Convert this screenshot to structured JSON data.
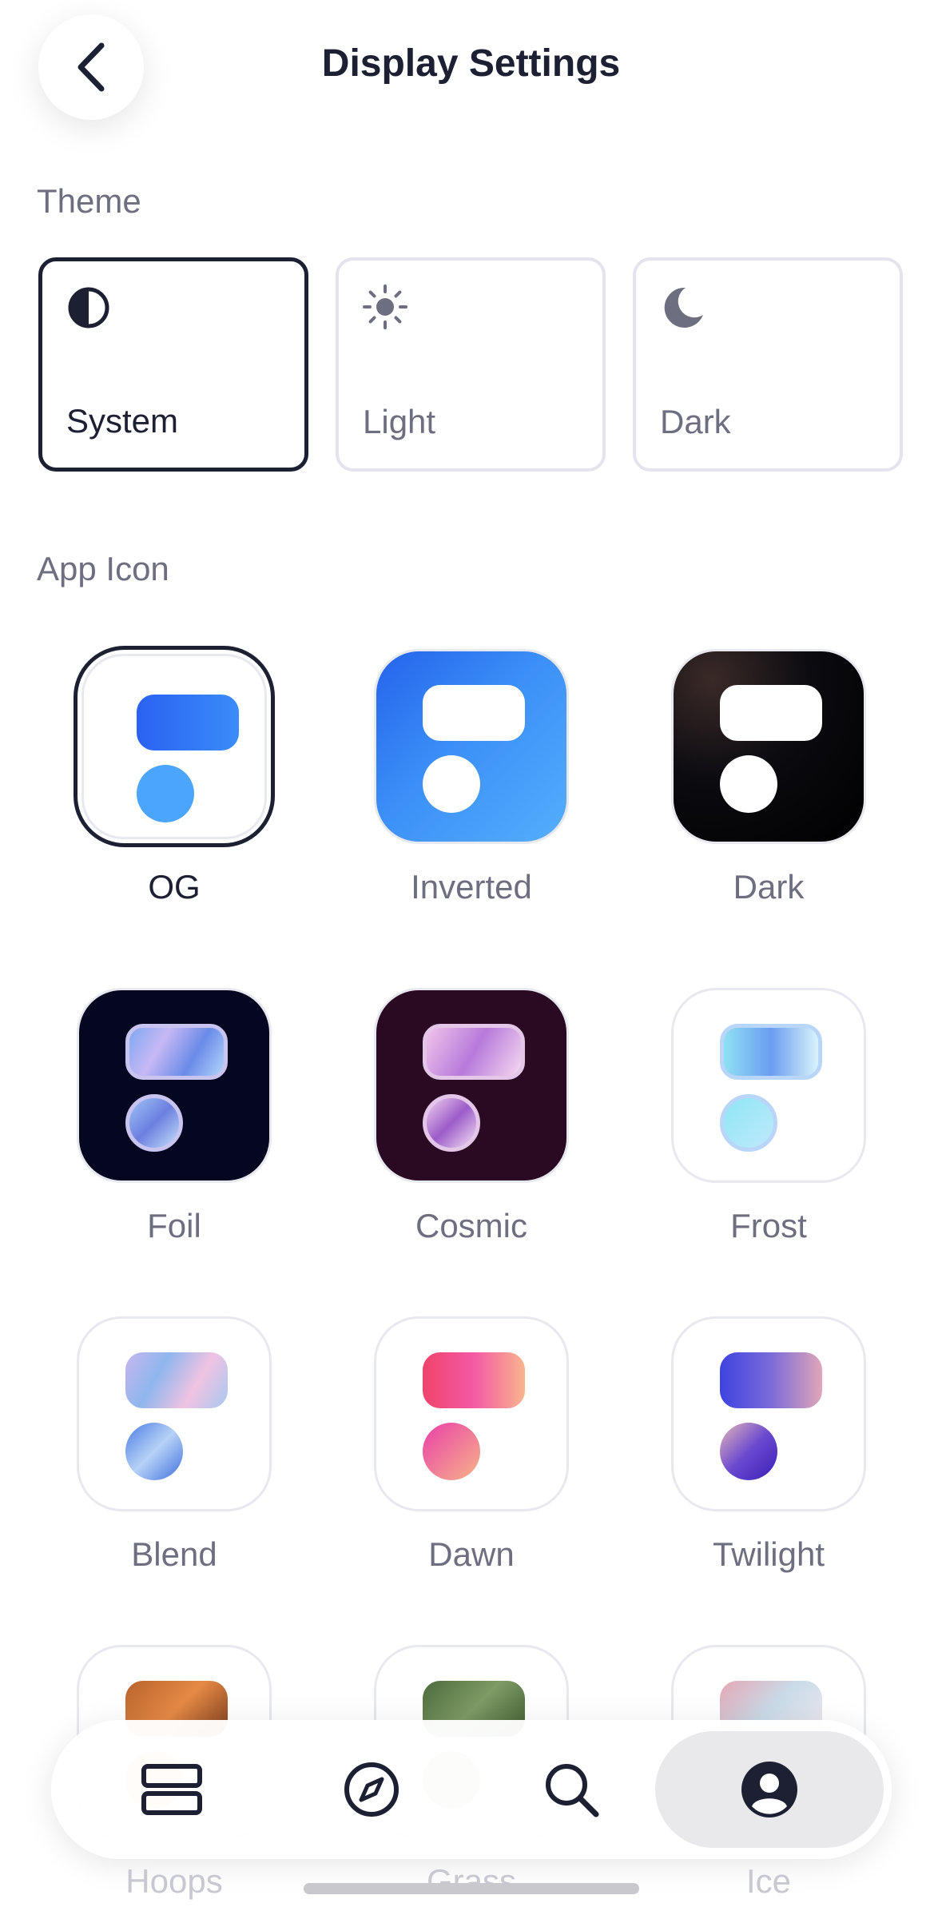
{
  "header": {
    "title": "Display Settings",
    "back_icon": "chevron-left-icon"
  },
  "theme": {
    "section_title": "Theme",
    "options": [
      {
        "label": "System",
        "icon": "half-circle-icon",
        "selected": true
      },
      {
        "label": "Light",
        "icon": "sun-icon",
        "selected": false
      },
      {
        "label": "Dark",
        "icon": "moon-icon",
        "selected": false
      }
    ]
  },
  "app_icon": {
    "section_title": "App Icon",
    "icons": [
      {
        "label": "OG",
        "selected": true
      },
      {
        "label": "Inverted"
      },
      {
        "label": "Dark"
      },
      {
        "label": "Foil"
      },
      {
        "label": "Cosmic"
      },
      {
        "label": "Frost"
      },
      {
        "label": "Blend"
      },
      {
        "label": "Dawn"
      },
      {
        "label": "Twilight"
      },
      {
        "label": "Hoops"
      },
      {
        "label": "Grass"
      },
      {
        "label": "Ice"
      }
    ]
  },
  "tab_bar": {
    "tabs": [
      {
        "name": "feed",
        "icon": "stacked-rectangles-icon",
        "active": false
      },
      {
        "name": "explore",
        "icon": "compass-icon",
        "active": false
      },
      {
        "name": "search",
        "icon": "search-icon",
        "active": false
      },
      {
        "name": "profile",
        "icon": "profile-icon",
        "active": true
      }
    ]
  },
  "colors": {
    "text_primary": "#1d1f33",
    "text_secondary": "#6d6f80",
    "border": "#e4e3ee",
    "brand_blue": "#2f6cf6",
    "brand_light_blue": "#4aa5fb"
  }
}
